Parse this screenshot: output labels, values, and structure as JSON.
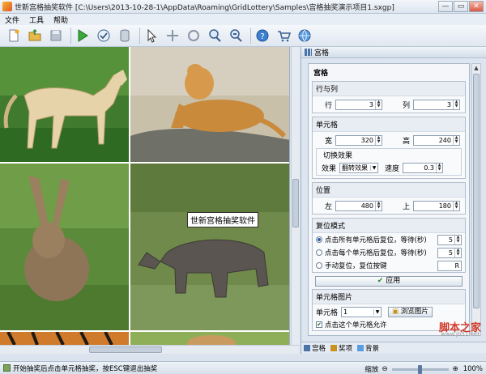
{
  "window": {
    "title": "世新宫格抽奖软件 [C:\\Users\\2013-10-28-1\\AppData\\Roaming\\GridLottery\\Samples\\宫格抽奖演示项目1.sxgp]",
    "controls": [
      "—",
      "▭",
      "✕"
    ]
  },
  "menu": [
    "文件",
    "工具",
    "帮助"
  ],
  "toolbar": [
    {
      "name": "new-doc-icon"
    },
    {
      "name": "open-folder-icon"
    },
    {
      "name": "save-icon"
    },
    {
      "name": "play-icon"
    },
    {
      "name": "check-icon"
    },
    {
      "name": "database-icon"
    },
    {
      "name": "cursor-icon"
    },
    {
      "name": "move-icon"
    },
    {
      "name": "loop-icon"
    },
    {
      "name": "zoom-in-icon"
    },
    {
      "name": "zoom-out-icon"
    },
    {
      "name": "help-icon"
    },
    {
      "name": "cart-icon"
    },
    {
      "name": "globe-icon"
    }
  ],
  "canvas": {
    "tooltip": "世新宫格抽奖软件",
    "cells": [
      "horse",
      "dog",
      "rabbit",
      "rhino",
      "tiger",
      "kitten"
    ]
  },
  "panel": {
    "header": "宫格",
    "section_title": "宫格",
    "rows_cols": {
      "title": "行与列",
      "row_label": "行",
      "row_value": "3",
      "col_label": "列",
      "col_value": "3"
    },
    "cell": {
      "title": "单元格",
      "width_label": "宽",
      "width_value": "320",
      "height_label": "高",
      "height_value": "240",
      "effect_group": "切换效果",
      "effect_label": "效果",
      "effect_value": "翻转效果",
      "speed_label": "速度",
      "speed_value": "0.3"
    },
    "position": {
      "title": "位置",
      "left_label": "左",
      "left_value": "480",
      "top_label": "上",
      "top_value": "180"
    },
    "reset": {
      "title": "复位模式",
      "option1": "点击所有单元格后复位，等待(秒)",
      "option1_value": "5",
      "option2": "点击每个单元格后复位，等待(秒)",
      "option2_value": "5",
      "option3": "手动复位，复位按键",
      "option3_value": "R"
    },
    "apply_label": "应用",
    "cell_image": {
      "title": "单元格图片",
      "cell_label": "单元格",
      "cell_value": "1",
      "browse_label": "浏览图片",
      "checkbox_label": "点击这个单元格允许"
    },
    "tabs": [
      "宫格",
      "奖项",
      "背景"
    ],
    "watermark": "脚本之家",
    "watermark_url": "www.jb51.net"
  },
  "status": {
    "text": "开始抽奖后点击单元格抽奖，按ESC键退出抽奖",
    "zoom_label": "缩放",
    "zoom_value": "100%",
    "zoom_fraction": 0.5
  },
  "colors": {
    "accent": "#2a5ea8",
    "watermark": "#d23b2c"
  }
}
